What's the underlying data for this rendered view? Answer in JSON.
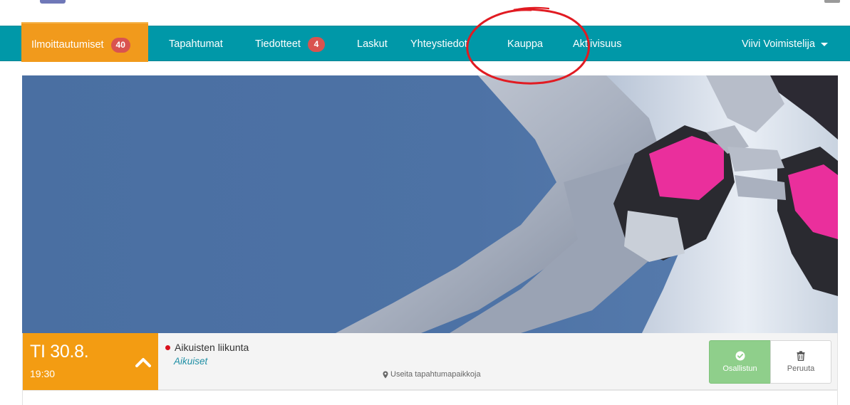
{
  "nav": {
    "items": [
      {
        "label": "Ilmoittautumiset",
        "badge": "40",
        "active": true
      },
      {
        "label": "Tapahtumat"
      },
      {
        "label": "Tiedotteet",
        "badge": "4"
      },
      {
        "label": "Laskut"
      },
      {
        "label": "Yhteystiedot"
      },
      {
        "label": "Kauppa"
      },
      {
        "label": "Aktiivisuus"
      }
    ],
    "user": {
      "name": "Viivi Voimistelija"
    }
  },
  "event": {
    "date": "TI 30.8.",
    "time": "19:30",
    "title": "Aikuisten liikunta",
    "group": "Aikuiset",
    "location": "Useita tapahtumapaikkoja",
    "attend_label": "Osallistun",
    "cancel_label": "Peruuta"
  },
  "colors": {
    "navbar": "#0098a8",
    "active_tab": "#f19a1c",
    "badge": "#d9534f",
    "date_box": "#f39c12",
    "attend_button": "#8fcf8b",
    "annotation": "#e11b22"
  }
}
